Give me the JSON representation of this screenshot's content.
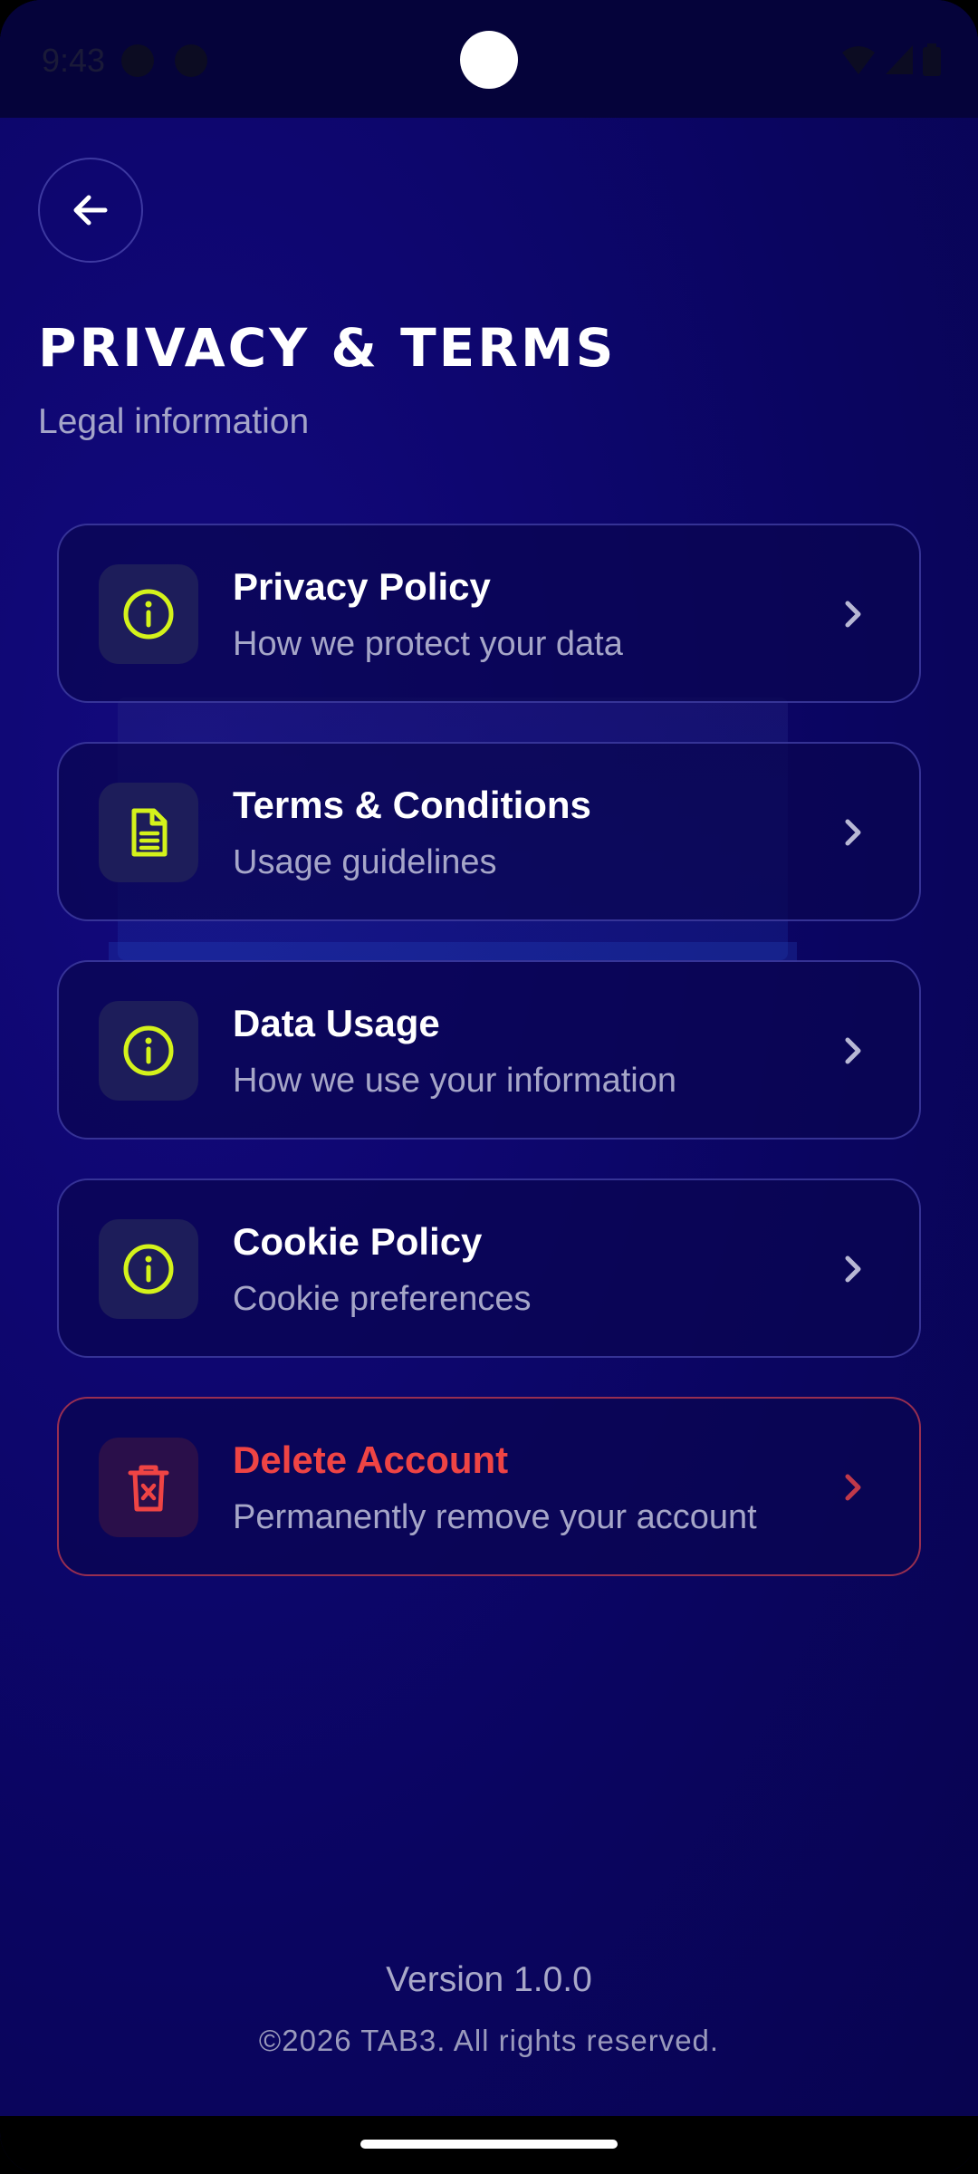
{
  "status_bar": {
    "time": "9:43"
  },
  "header": {
    "back_icon": "arrow-left-icon",
    "title": "PRIVACY & TERMS",
    "subtitle": "Legal information"
  },
  "items": [
    {
      "title": "Privacy Policy",
      "description": "How we protect your data",
      "icon": "info-circle-icon"
    },
    {
      "title": "Terms & Conditions",
      "description": "Usage guidelines",
      "icon": "document-icon"
    },
    {
      "title": "Data Usage",
      "description": "How we use your information",
      "icon": "info-circle-icon"
    },
    {
      "title": "Cookie Policy",
      "description": "Cookie preferences",
      "icon": "info-circle-icon"
    },
    {
      "title": "Delete Account",
      "description": "Permanently remove your account",
      "icon": "trash-x-icon"
    }
  ],
  "footer": {
    "version": "Version 1.0.0",
    "copyright": "©2026 TAB3. All rights reserved."
  },
  "colors": {
    "accent": "#d4f21b",
    "danger": "#ef4444",
    "background": "#0c0566"
  }
}
